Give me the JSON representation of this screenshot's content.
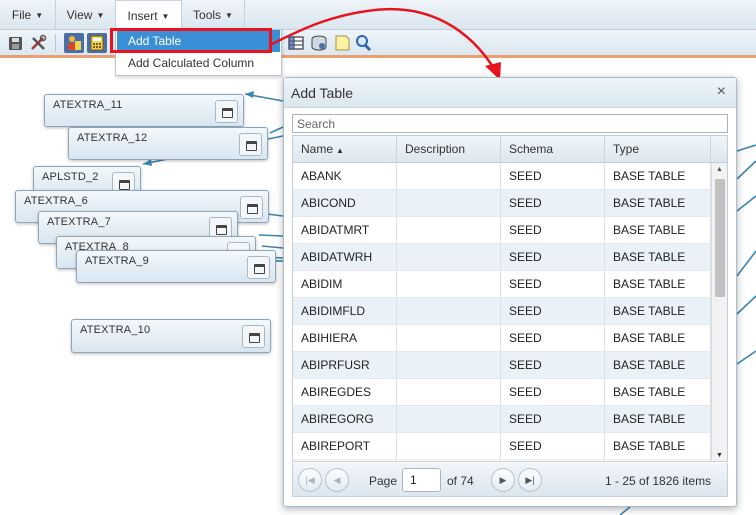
{
  "menubar": {
    "items": [
      {
        "label": "File"
      },
      {
        "label": "View"
      },
      {
        "label": "Insert"
      },
      {
        "label": "Tools"
      }
    ],
    "caret": "▼"
  },
  "toolbar": {
    "buttons": [
      "save-icon",
      "tools-icon",
      "shapes-icon",
      "calculator-icon",
      "table-view-icon",
      "database-icon",
      "note-icon",
      "magnify-icon"
    ]
  },
  "insert_menu": {
    "items": [
      {
        "label": "Add Table"
      },
      {
        "label": "Add Calculated Column"
      }
    ]
  },
  "canvas": {
    "connector_color": "#3a86b0",
    "arrow_color": "#e8131d",
    "nodes": [
      {
        "label": "ATEXTRA_11"
      },
      {
        "label": "ATEXTRA_12"
      },
      {
        "label": "APLSTD_2"
      },
      {
        "label": "ATEXTRA_6"
      },
      {
        "label": "ATEXTRA_7"
      },
      {
        "label": "ATEXTRA_8"
      },
      {
        "label": "ATEXTRA_9"
      },
      {
        "label": "ATEXTRA_10"
      }
    ]
  },
  "dialog": {
    "title": "Add Table",
    "close_icon": "×",
    "search": {
      "placeholder": "Search",
      "value": ""
    },
    "columns": [
      {
        "label": "Name",
        "sort": "▲"
      },
      {
        "label": "Description"
      },
      {
        "label": "Schema"
      },
      {
        "label": "Type"
      }
    ],
    "rows": [
      {
        "name": "ABANK",
        "description": "",
        "schema": "SEED",
        "type": "BASE TABLE"
      },
      {
        "name": "ABICOND",
        "description": "",
        "schema": "SEED",
        "type": "BASE TABLE"
      },
      {
        "name": "ABIDATMRT",
        "description": "",
        "schema": "SEED",
        "type": "BASE TABLE"
      },
      {
        "name": "ABIDATWRH",
        "description": "",
        "schema": "SEED",
        "type": "BASE TABLE"
      },
      {
        "name": "ABIDIM",
        "description": "",
        "schema": "SEED",
        "type": "BASE TABLE"
      },
      {
        "name": "ABIDIMFLD",
        "description": "",
        "schema": "SEED",
        "type": "BASE TABLE"
      },
      {
        "name": "ABIHIERA",
        "description": "",
        "schema": "SEED",
        "type": "BASE TABLE"
      },
      {
        "name": "ABIPRFUSR",
        "description": "",
        "schema": "SEED",
        "type": "BASE TABLE"
      },
      {
        "name": "ABIREGDES",
        "description": "",
        "schema": "SEED",
        "type": "BASE TABLE"
      },
      {
        "name": "ABIREGORG",
        "description": "",
        "schema": "SEED",
        "type": "BASE TABLE"
      },
      {
        "name": "ABIREPORT",
        "description": "",
        "schema": "SEED",
        "type": "BASE TABLE"
      }
    ],
    "pager": {
      "page_label": "Page",
      "page_value": "1",
      "of_label": "of 74",
      "summary": "1 - 25 of 1826 items",
      "first_icon": "|◀",
      "prev_icon": "◀",
      "next_icon": "▶",
      "last_icon": "▶|"
    }
  }
}
